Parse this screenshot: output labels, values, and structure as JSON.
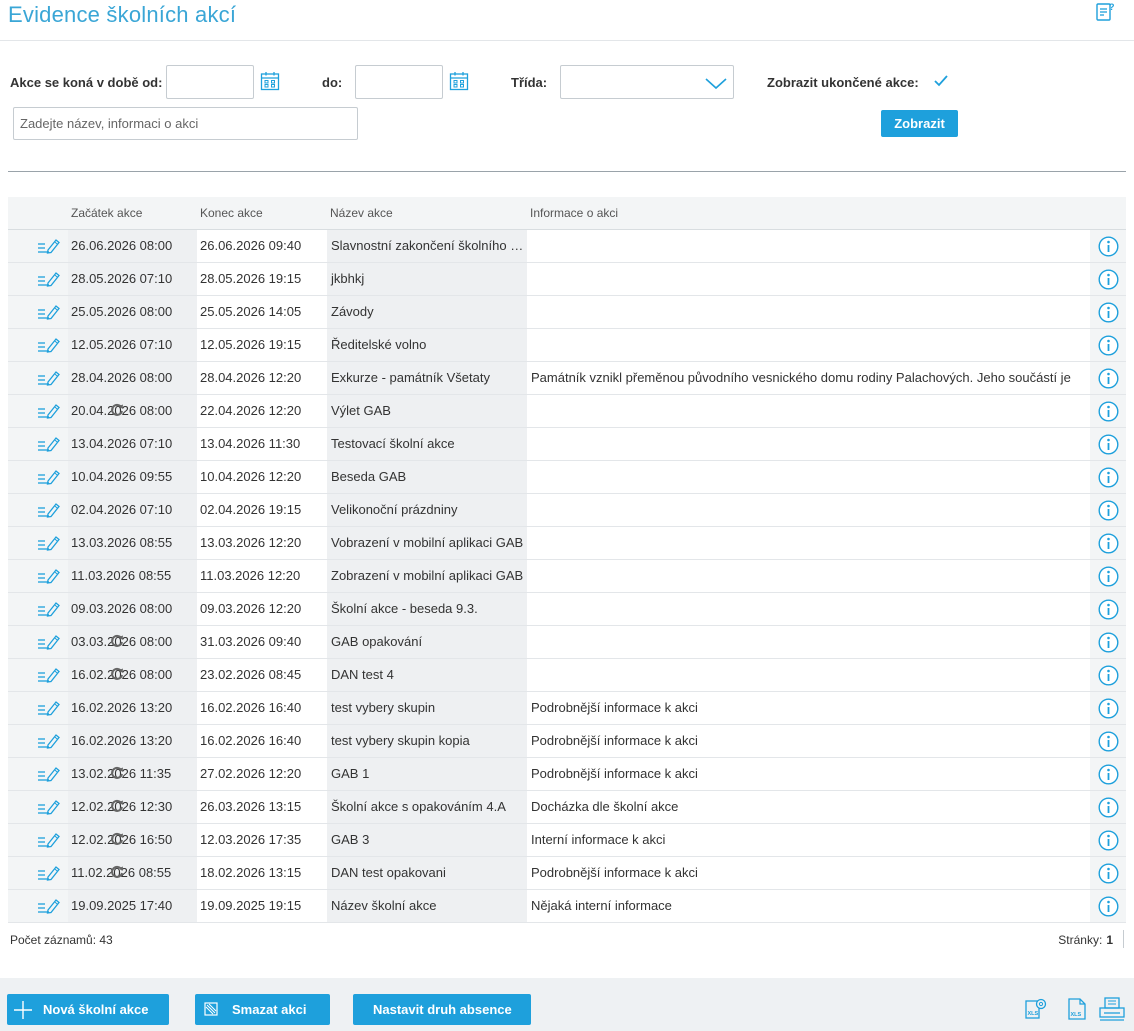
{
  "header": {
    "title": "Evidence školních akcí"
  },
  "filters": {
    "date_from_label": "Akce se koná v době od:",
    "date_from_value": "",
    "date_to_label": "do:",
    "date_to_value": "",
    "class_label": "Třída:",
    "class_value": "",
    "show_finished_label": "Zobrazit ukončené akce:",
    "search_placeholder": "Zadejte název, informaci o akci",
    "show_button": "Zobrazit"
  },
  "grid": {
    "columns": [
      "Začátek akce",
      "Konec akce",
      "Název akce",
      "Informace o akci"
    ],
    "rows": [
      {
        "start": "26.06.2026 08:00",
        "end": "26.06.2026 09:40",
        "name": "Slavnostní zakončení školního roku",
        "info": "",
        "repeat": false
      },
      {
        "start": "28.05.2026 07:10",
        "end": "28.05.2026 19:15",
        "name": "jkbhkj",
        "info": "",
        "repeat": false
      },
      {
        "start": "25.05.2026 08:00",
        "end": "25.05.2026 14:05",
        "name": "Závody",
        "info": "",
        "repeat": false
      },
      {
        "start": "12.05.2026 07:10",
        "end": "12.05.2026 19:15",
        "name": "Ředitelské volno",
        "info": "",
        "repeat": false
      },
      {
        "start": "28.04.2026 08:00",
        "end": "28.04.2026 12:20",
        "name": "Exkurze - památník Všetaty",
        "info": "Památník vznikl přeměnou původního vesnického domu rodiny Palachových. Jeho součástí je",
        "repeat": false
      },
      {
        "start": "20.04.2026 08:00",
        "end": "22.04.2026 12:20",
        "name": "Výlet GAB",
        "info": "",
        "repeat": true
      },
      {
        "start": "13.04.2026 07:10",
        "end": "13.04.2026 11:30",
        "name": "Testovací školní akce",
        "info": "",
        "repeat": false
      },
      {
        "start": "10.04.2026 09:55",
        "end": "10.04.2026 12:20",
        "name": "Beseda GAB",
        "info": "",
        "repeat": false
      },
      {
        "start": "02.04.2026 07:10",
        "end": "02.04.2026 19:15",
        "name": "Velikonoční prázdniny",
        "info": "",
        "repeat": false
      },
      {
        "start": "13.03.2026 08:55",
        "end": "13.03.2026 12:20",
        "name": "Vobrazení v mobilní aplikaci GAB",
        "info": "",
        "repeat": false
      },
      {
        "start": "11.03.2026 08:55",
        "end": "11.03.2026 12:20",
        "name": "Zobrazení v mobilní aplikaci GAB",
        "info": "",
        "repeat": false
      },
      {
        "start": "09.03.2026 08:00",
        "end": "09.03.2026 12:20",
        "name": "Školní akce - beseda 9.3.",
        "info": "",
        "repeat": false
      },
      {
        "start": "03.03.2026 08:00",
        "end": "31.03.2026 09:40",
        "name": "GAB opakování",
        "info": "",
        "repeat": true
      },
      {
        "start": "16.02.2026 08:00",
        "end": "23.02.2026 08:45",
        "name": "DAN test 4",
        "info": "",
        "repeat": true
      },
      {
        "start": "16.02.2026 13:20",
        "end": "16.02.2026 16:40",
        "name": "test vybery skupin",
        "info": "Podrobnější informace k akci",
        "repeat": false
      },
      {
        "start": "16.02.2026 13:20",
        "end": "16.02.2026 16:40",
        "name": "test vybery skupin kopia",
        "info": "Podrobnější informace k akci",
        "repeat": false
      },
      {
        "start": "13.02.2026 11:35",
        "end": "27.02.2026 12:20",
        "name": "GAB 1",
        "info": "Podrobnější informace k akci",
        "repeat": true
      },
      {
        "start": "12.02.2026 12:30",
        "end": "26.03.2026 13:15",
        "name": "Školní akce s opakováním 4.A",
        "info": "Docházka dle školní akce",
        "repeat": true
      },
      {
        "start": "12.02.2026 16:50",
        "end": "12.03.2026 17:35",
        "name": "GAB 3",
        "info": "Interní informace k akci",
        "repeat": true
      },
      {
        "start": "11.02.2026 08:55",
        "end": "18.02.2026 13:15",
        "name": "DAN test opakovani",
        "info": "Podrobnější informace k akci",
        "repeat": true
      },
      {
        "start": "19.09.2025 17:40",
        "end": "19.09.2025 19:15",
        "name": "Název školní akce",
        "info": "Nějaká interní informace",
        "repeat": false
      }
    ]
  },
  "footer": {
    "record_count": "Počet záznamů: 43",
    "pages_label": "Stránky:",
    "page_current": "1"
  },
  "actions": {
    "new_event": "Nová školní akce",
    "delete_event": "Smazat akci",
    "set_absence": "Nastavit druh absence"
  },
  "colors": {
    "accent": "#1ea0dc",
    "title": "#3aa6d6"
  }
}
